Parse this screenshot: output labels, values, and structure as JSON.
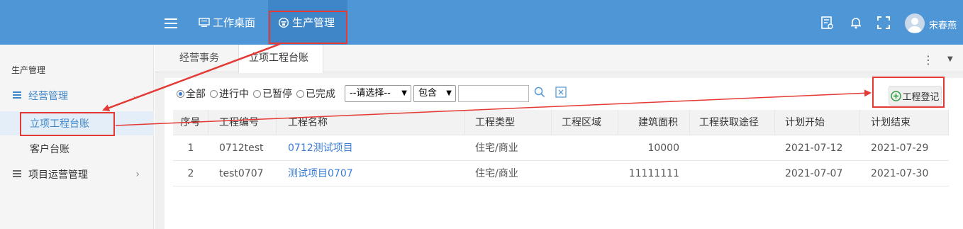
{
  "header": {
    "nav": [
      {
        "label": "工作桌面",
        "active": false
      },
      {
        "label": "生产管理",
        "active": true
      }
    ],
    "user": "宋春燕",
    "icons": [
      "menu-icon",
      "monitor-icon",
      "factory-icon",
      "report-icon",
      "bell-icon",
      "fullscreen-icon",
      "user-avatar"
    ]
  },
  "sidebar": {
    "title": "生产管理",
    "groups": [
      {
        "label": "经营管理",
        "expanded": true,
        "items": [
          {
            "label": "立项工程台账",
            "active": true
          },
          {
            "label": "客户台账",
            "active": false
          }
        ]
      },
      {
        "label": "项目运营管理",
        "expanded": false,
        "items": []
      }
    ]
  },
  "tabs": [
    {
      "label": "经营事务",
      "active": false
    },
    {
      "label": "立项工程台账",
      "active": true
    }
  ],
  "filters": {
    "radios": [
      {
        "label": "全部",
        "checked": true
      },
      {
        "label": "进行中",
        "checked": false
      },
      {
        "label": "已暂停",
        "checked": false
      },
      {
        "label": "已完成",
        "checked": false
      }
    ],
    "field_select": "--请选择--",
    "op_select": "包含",
    "keyword": ""
  },
  "buttons": {
    "register": "工程登记"
  },
  "table": {
    "columns": [
      "序号",
      "工程编号",
      "工程名称",
      "工程类型",
      "工程区域",
      "建筑面积",
      "工程获取途径",
      "计划开始",
      "计划结束"
    ],
    "rows": [
      {
        "no": "1",
        "code": "0712test",
        "name": "0712测试项目",
        "type": "住宅/商业",
        "area": "",
        "size": "10000",
        "source": "",
        "start": "2021-07-12",
        "end": "2021-07-29"
      },
      {
        "no": "2",
        "code": "test0707",
        "name": "测试项目0707",
        "type": "住宅/商业",
        "area": "",
        "size": "11111111",
        "source": "",
        "start": "2021-07-07",
        "end": "2021-07-30"
      }
    ]
  },
  "colors": {
    "topbar": "#4f96d6",
    "accent": "#3a7bd5",
    "annotation": "#e53935"
  }
}
